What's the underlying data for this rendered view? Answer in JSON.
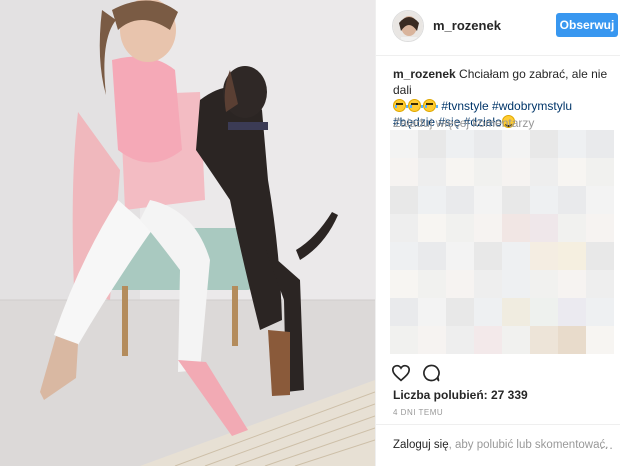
{
  "post": {
    "username": "m_rozenek",
    "follow_label": "Obserwuj",
    "caption_user": "m_rozenek",
    "caption_text": "Chciałam go zabrać, ale nie dali",
    "hashtags_line1": "#tvnstyle #wdobrymstylu",
    "hashtags_line2": "#będzie #się #działo",
    "load_more_label": "Załaduj więcej komentarzy",
    "likes_label": "Liczba polubień: 27 339",
    "time_ago": "4 DNI TEMU",
    "login_link": "Zaloguj się",
    "login_suffix": ", aby polubić lub skomentować.",
    "more_label": "..."
  },
  "icons": {
    "like": "heart-outline-icon",
    "comment": "speech-bubble-icon",
    "avatar": "profile-photo"
  },
  "colors": {
    "accent": "#3897f0",
    "hashtag": "#003569",
    "muted": "#999999",
    "text": "#262626",
    "border": "#efefef"
  }
}
